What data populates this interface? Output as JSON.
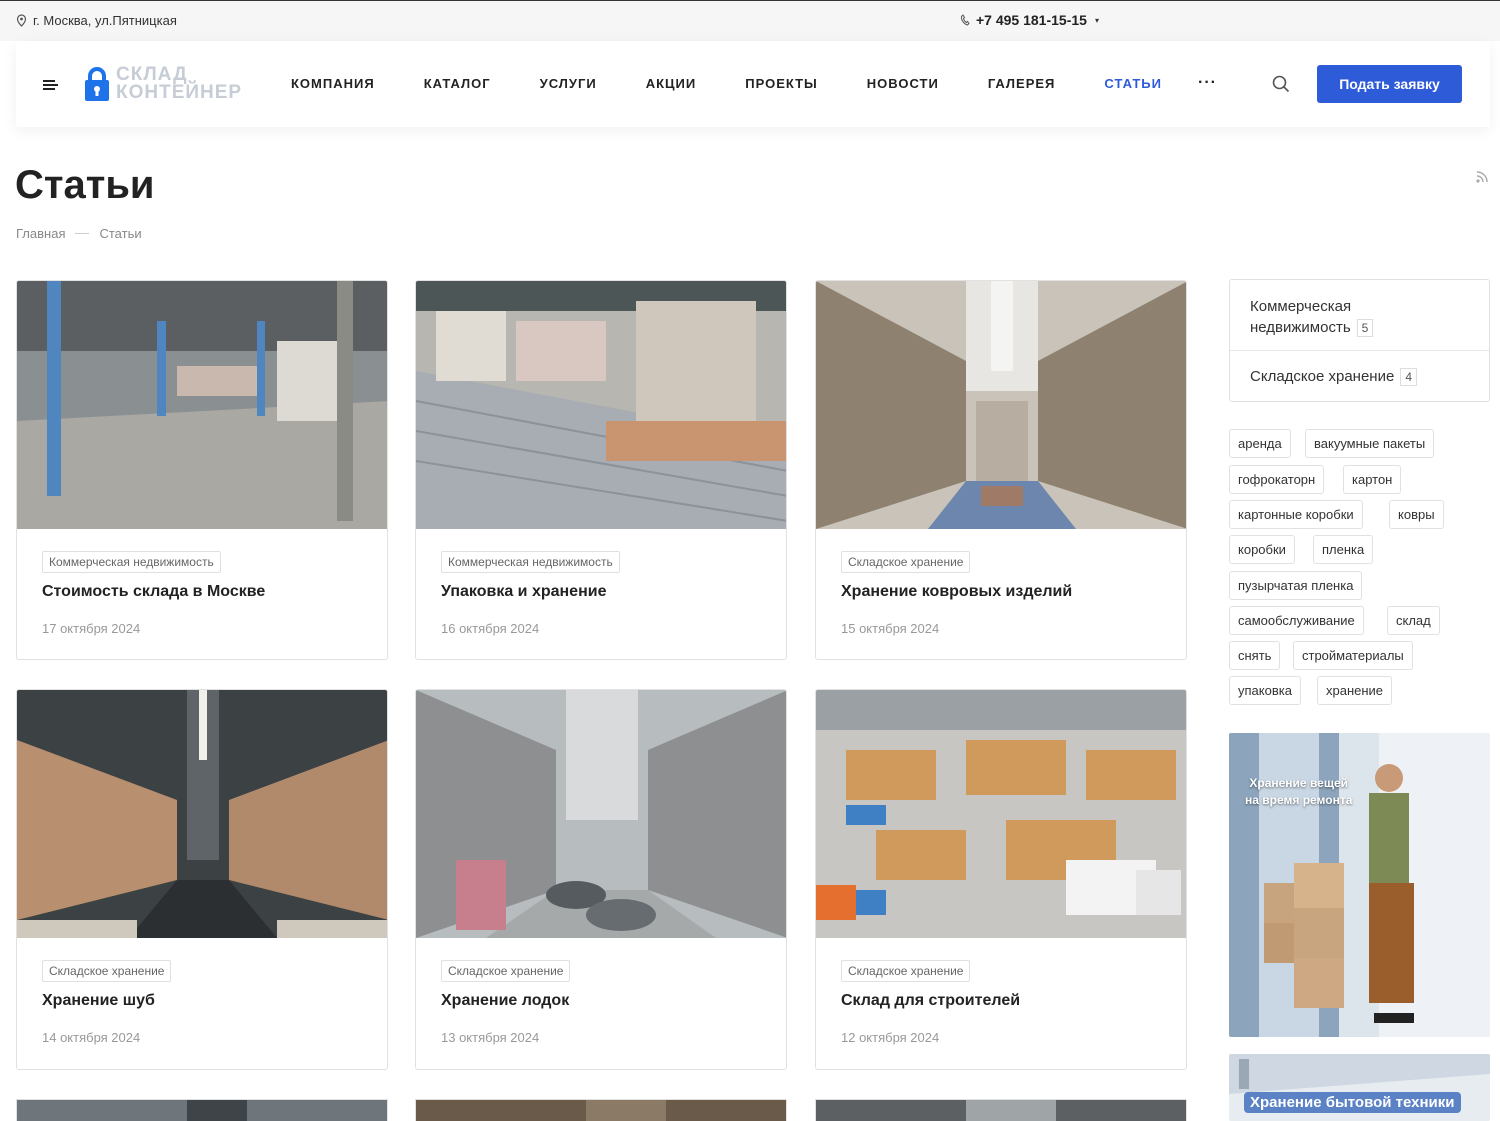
{
  "topbar": {
    "address": "г. Москва, ул.Пятницкая",
    "phone": "+7 495 181-15-15",
    "phone_caret": "▾"
  },
  "header": {
    "logo_line1": "СКЛАД",
    "logo_line2": "КОНТЕЙНЕР",
    "nav": [
      "КОМПАНИЯ",
      "КАТАЛОГ",
      "УСЛУГИ",
      "АКЦИИ",
      "ПРОЕКТЫ",
      "НОВОСТИ",
      "ГАЛЕРЕЯ",
      "СТАТЬИ"
    ],
    "active_nav": "СТАТЬИ",
    "more": "···",
    "cta_label": "Подать заявку"
  },
  "page": {
    "title": "Статьи",
    "breadcrumb": [
      "Главная",
      "Статьи"
    ]
  },
  "articles": [
    {
      "tag": "Коммерческая недвижимость",
      "title": "Стоимость склада в Москве",
      "date": "17 октября 2024"
    },
    {
      "tag": "Коммерческая недвижимость",
      "title": "Упаковка и хранение",
      "date": "16 октября 2024"
    },
    {
      "tag": "Складское хранение",
      "title": "Хранение ковровых изделий",
      "date": "15 октября 2024"
    },
    {
      "tag": "Складское хранение",
      "title": "Хранение шуб",
      "date": "14 октября 2024"
    },
    {
      "tag": "Складское хранение",
      "title": "Хранение лодок",
      "date": "13 октября 2024"
    },
    {
      "tag": "Складское хранение",
      "title": "Склад для строителей",
      "date": "12 октября 2024"
    }
  ],
  "sidebar": {
    "categories": [
      {
        "label_line1": "Коммерческая",
        "label_line2": "недвижимость",
        "count": "5"
      },
      {
        "label": "Складское хранение",
        "count": "4"
      }
    ],
    "tags": [
      "аренда",
      "вакуумные пакеты",
      "гофрокаторн",
      "картон",
      "картонные коробки",
      "ковры",
      "коробки",
      "пленка",
      "пузырчатая пленка",
      "самообслуживание",
      "склад",
      "снять",
      "стройматериалы",
      "упаковка",
      "хранение"
    ],
    "banner_text_line1": "Хранение вещей",
    "banner_text_line2": "на время ремонта",
    "banner2_text": "Хранение бытовой техники"
  },
  "colors": {
    "accent": "#2e5bd8",
    "logo_blue": "#1e73e8",
    "logo_gray": "#c7cdd6"
  },
  "icons": [
    "location-pin-icon",
    "phone-icon",
    "burger-menu-icon",
    "lock-logo-icon",
    "search-icon",
    "rss-icon"
  ]
}
